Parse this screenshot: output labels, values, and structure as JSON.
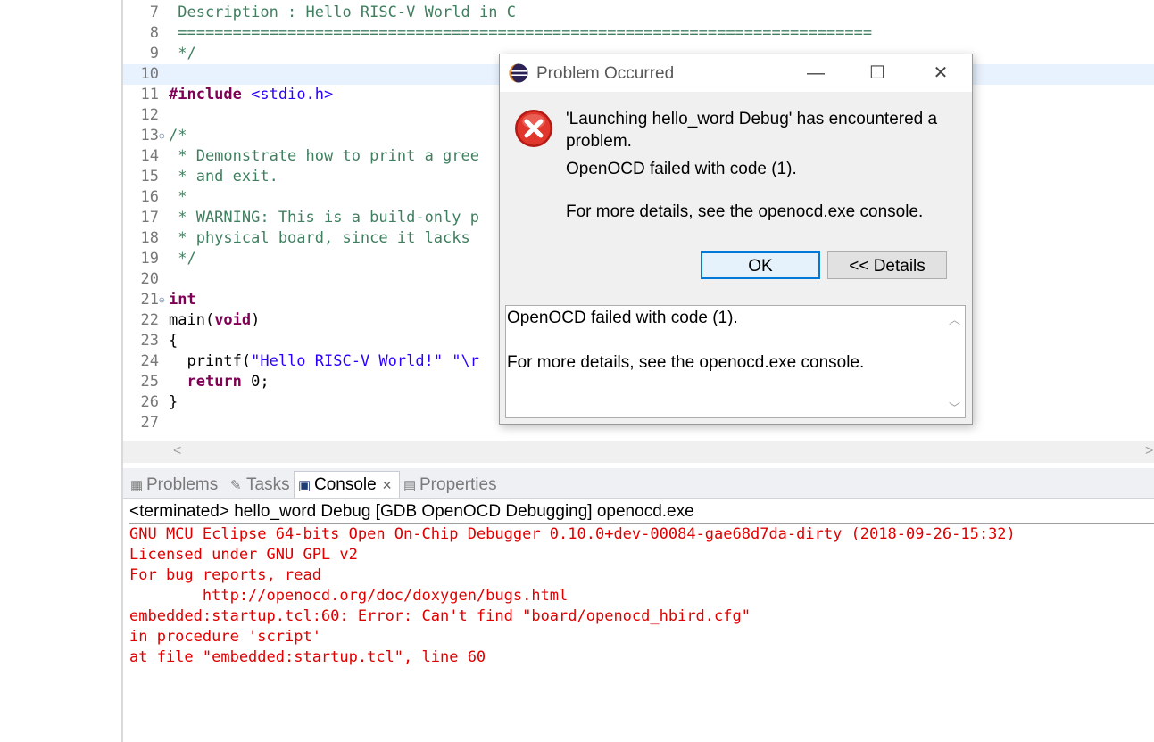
{
  "editor": {
    "lines": [
      {
        "num": "7",
        "fold": "",
        "current": false,
        "segments": [
          {
            "cls": "c-comment",
            "text": " Description : Hello RISC-V World in C"
          }
        ]
      },
      {
        "num": "8",
        "fold": "",
        "current": false,
        "segments": [
          {
            "cls": "c-comment",
            "text": " ============================================================================"
          }
        ]
      },
      {
        "num": "9",
        "fold": "",
        "current": false,
        "segments": [
          {
            "cls": "c-comment",
            "text": " */"
          }
        ]
      },
      {
        "num": "10",
        "fold": "",
        "current": true,
        "segments": []
      },
      {
        "num": "11",
        "fold": "",
        "current": false,
        "segments": [
          {
            "cls": "c-kw",
            "text": "#include"
          },
          {
            "cls": "c-plain",
            "text": " "
          },
          {
            "cls": "c-inc",
            "text": "<stdio.h>"
          }
        ]
      },
      {
        "num": "12",
        "fold": "",
        "current": false,
        "segments": []
      },
      {
        "num": "13",
        "fold": "⊖",
        "current": false,
        "segments": [
          {
            "cls": "c-comment",
            "text": "/*"
          }
        ]
      },
      {
        "num": "14",
        "fold": "",
        "current": false,
        "segments": [
          {
            "cls": "c-comment",
            "text": " * Demonstrate how to print a gree"
          }
        ]
      },
      {
        "num": "15",
        "fold": "",
        "current": false,
        "segments": [
          {
            "cls": "c-comment",
            "text": " * and exit."
          }
        ]
      },
      {
        "num": "16",
        "fold": "",
        "current": false,
        "segments": [
          {
            "cls": "c-comment",
            "text": " *"
          }
        ]
      },
      {
        "num": "17",
        "fold": "",
        "current": false,
        "segments": [
          {
            "cls": "c-comment",
            "text": " * WARNING: This is a build-only p"
          }
        ]
      },
      {
        "num": "18",
        "fold": "",
        "current": false,
        "segments": [
          {
            "cls": "c-comment",
            "text": " * physical board, since it lacks"
          }
        ]
      },
      {
        "num": "19",
        "fold": "",
        "current": false,
        "segments": [
          {
            "cls": "c-comment",
            "text": " */"
          }
        ]
      },
      {
        "num": "20",
        "fold": "",
        "current": false,
        "segments": []
      },
      {
        "num": "21",
        "fold": "⊖",
        "current": false,
        "segments": [
          {
            "cls": "c-kw",
            "text": "int"
          }
        ]
      },
      {
        "num": "22",
        "fold": "",
        "current": false,
        "segments": [
          {
            "cls": "c-plain",
            "text": "main("
          },
          {
            "cls": "c-kw",
            "text": "void"
          },
          {
            "cls": "c-plain",
            "text": ")"
          }
        ]
      },
      {
        "num": "23",
        "fold": "",
        "current": false,
        "segments": [
          {
            "cls": "c-plain",
            "text": "{"
          }
        ]
      },
      {
        "num": "24",
        "fold": "",
        "current": false,
        "segments": [
          {
            "cls": "c-plain",
            "text": "  printf("
          },
          {
            "cls": "c-str",
            "text": "\"Hello RISC-V World!\" \"\\r"
          }
        ]
      },
      {
        "num": "25",
        "fold": "",
        "current": false,
        "segments": [
          {
            "cls": "c-plain",
            "text": "  "
          },
          {
            "cls": "c-kw",
            "text": "return"
          },
          {
            "cls": "c-plain",
            "text": " 0;"
          }
        ]
      },
      {
        "num": "26",
        "fold": "",
        "current": false,
        "segments": [
          {
            "cls": "c-plain",
            "text": "}"
          }
        ]
      },
      {
        "num": "27",
        "fold": "",
        "current": false,
        "segments": []
      }
    ],
    "scroll_left": "<",
    "scroll_right": ">"
  },
  "views": {
    "tabs": [
      {
        "label": "Problems",
        "icon": "▦",
        "icon_name": "problems-icon",
        "active": false,
        "close": ""
      },
      {
        "label": "Tasks",
        "icon": "✎",
        "icon_name": "tasks-icon",
        "active": false,
        "close": ""
      },
      {
        "label": "Console",
        "icon": "▣",
        "icon_name": "console-icon",
        "active": true,
        "close": "✕"
      },
      {
        "label": "Properties",
        "icon": "▤",
        "icon_name": "properties-icon",
        "active": false,
        "close": ""
      }
    ],
    "console_header": "<terminated> hello_word Debug [GDB OpenOCD Debugging] openocd.exe",
    "console_lines": [
      "GNU MCU Eclipse 64-bits Open On-Chip Debugger 0.10.0+dev-00084-gae68d7da-dirty (2018-09-26-15:32)",
      "Licensed under GNU GPL v2",
      "For bug reports, read",
      "        http://openocd.org/doc/doxygen/bugs.html",
      "embedded:startup.tcl:60: Error: Can't find \"board/openocd_hbird.cfg\"",
      "in procedure 'script'",
      "at file \"embedded:startup.tcl\", line 60"
    ]
  },
  "dialog": {
    "title": "Problem Occurred",
    "minimize": "—",
    "maximize": "☐",
    "close": "✕",
    "message": "'Launching hello_word Debug' has encountered a problem.",
    "code_line": "OpenOCD failed with code (1).",
    "details_hint": "For more details, see the openocd.exe console.",
    "ok_label": "OK",
    "details_label": "<< Details",
    "details_text": {
      "line1": "OpenOCD failed with code (1).",
      "line2": "For more details, see the openocd.exe console."
    },
    "colors": {
      "error_red": "#d9251d",
      "ok_border": "#0078d7"
    }
  }
}
